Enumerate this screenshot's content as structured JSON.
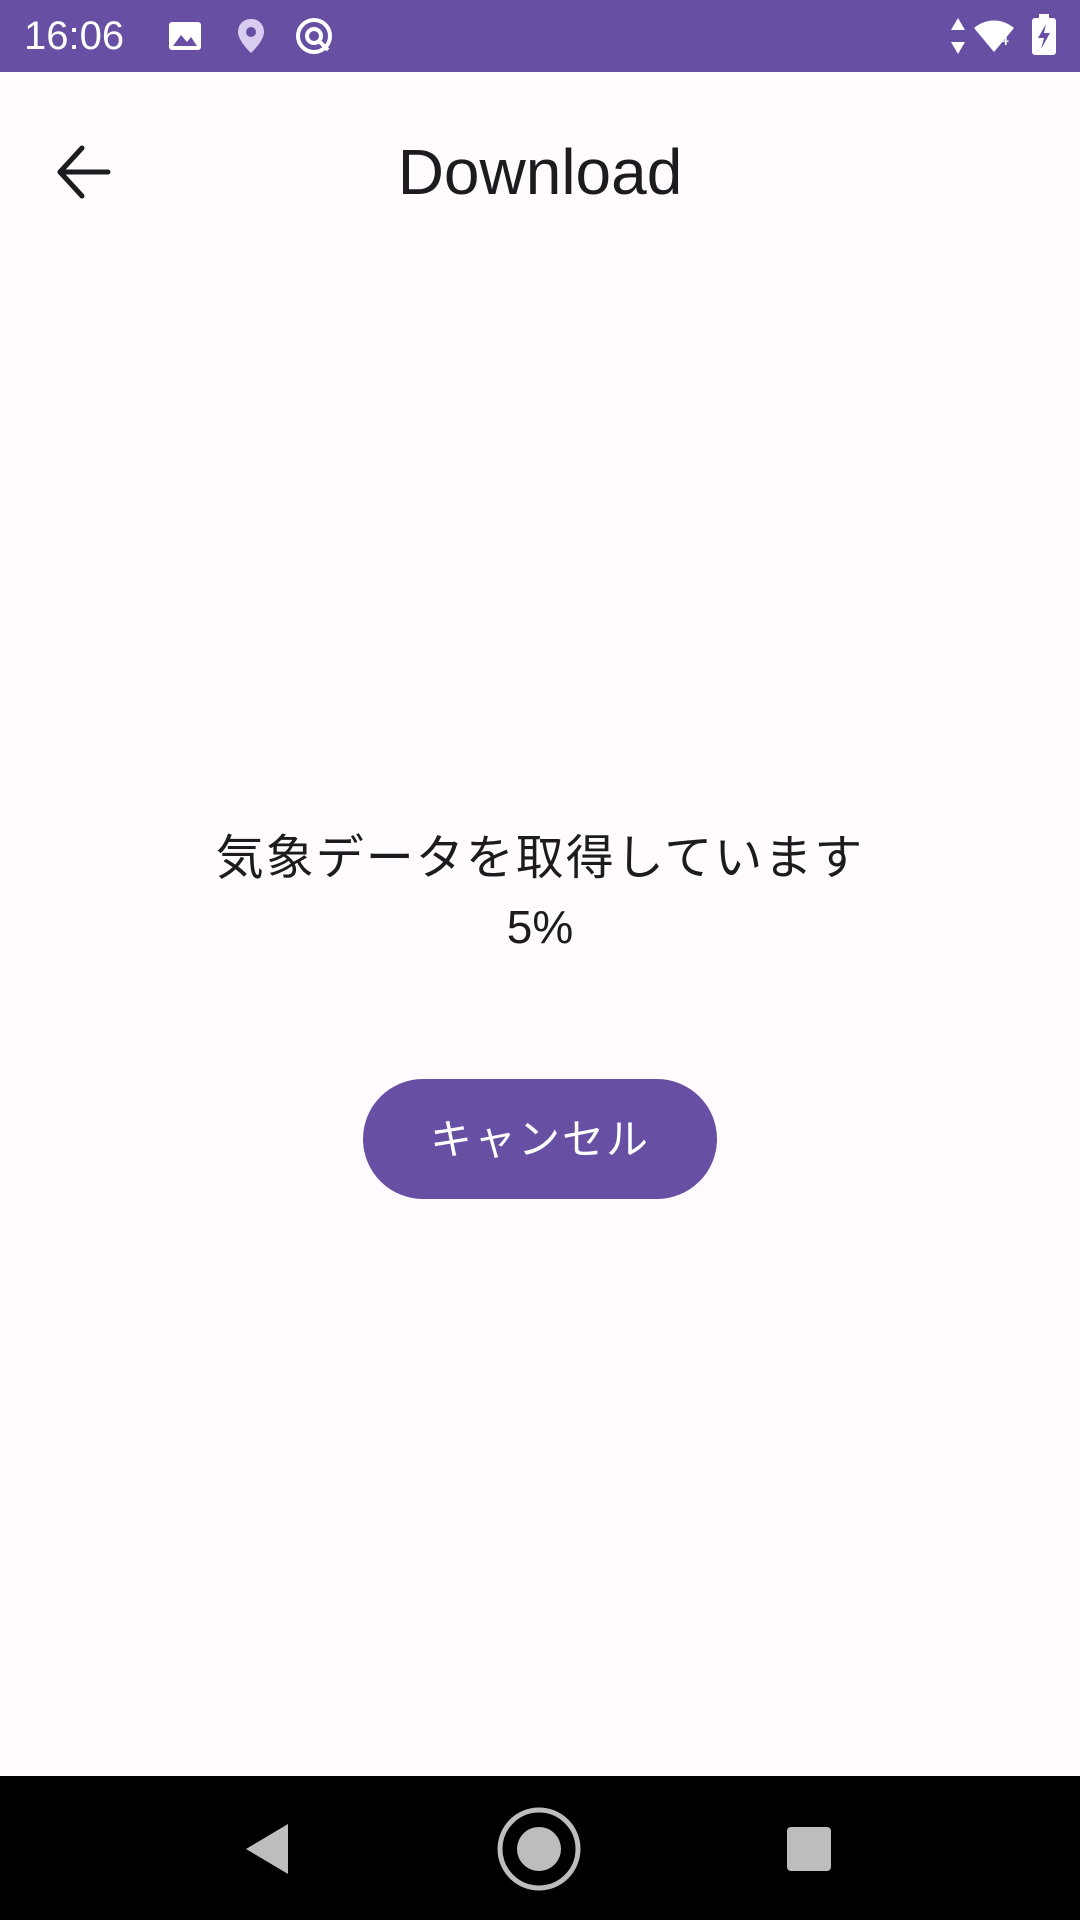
{
  "status_bar": {
    "time": "16:06",
    "left_icons": [
      "image-icon",
      "location-pin-icon",
      "at-sign-icon"
    ],
    "right_icons": [
      "data-arrows-icon",
      "wifi-icon",
      "battery-charging-icon"
    ],
    "wifi_badge": "4",
    "background_color": "#6750A4"
  },
  "top_bar": {
    "back_icon": "arrow-back-icon",
    "title": "Download"
  },
  "main": {
    "message": "気象データを取得しています",
    "percent_text": "5%",
    "progress_value": 5,
    "cancel_label": "キャンセル",
    "accent_color": "#6750A4"
  },
  "nav_bar": {
    "buttons": [
      "back-triangle-icon",
      "home-circle-icon",
      "recents-square-icon"
    ]
  }
}
